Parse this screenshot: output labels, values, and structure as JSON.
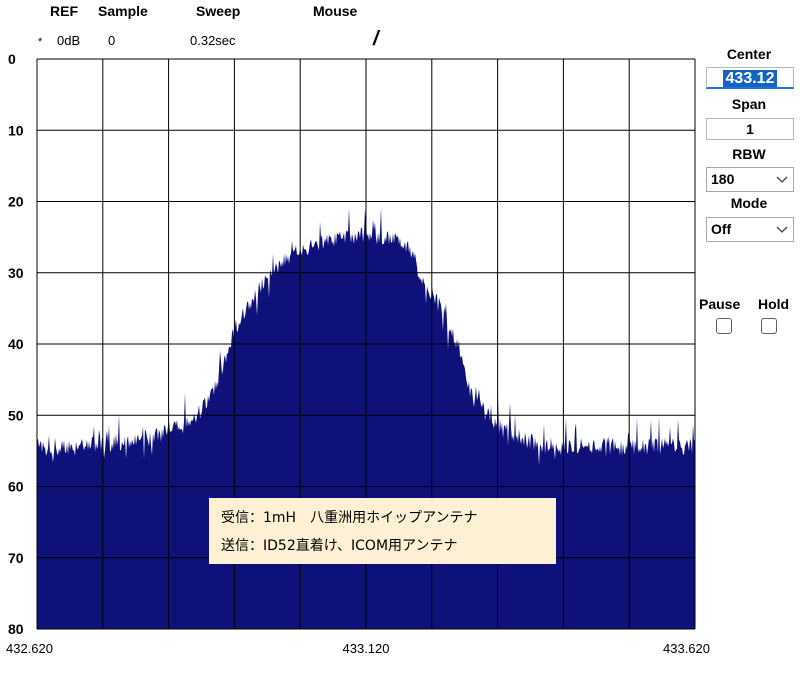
{
  "header": {
    "ref_label": "REF",
    "sample_label": "Sample",
    "sweep_label": "Sweep",
    "mouse_label": "Mouse",
    "ref_marker": "*",
    "ref_value": "0dB",
    "sample_value": "0",
    "sweep_value": "0.32sec",
    "mouse_value": "/"
  },
  "controls": {
    "center_label": "Center",
    "center_value": "433.12",
    "span_label": "Span",
    "span_value": "1",
    "rbw_label": "RBW",
    "rbw_value": "180",
    "mode_label": "Mode",
    "mode_value": "Off",
    "pause_label": "Pause",
    "hold_label": "Hold"
  },
  "annotation": {
    "line1": "受信：1mH　八重洲用ホイップアンテナ",
    "line2": "送信：ID52直着け、ICOM用アンテナ"
  },
  "colors": {
    "trace": "#0f117a",
    "grid": "#000000",
    "highlight": "#1565c0"
  },
  "icons": {
    "dropdown": "chevron-down-icon"
  },
  "chart_data": {
    "type": "area",
    "title": "",
    "xlabel": "",
    "ylabel": "",
    "x_ticks": [
      "432.620",
      "433.120",
      "433.620"
    ],
    "y_ticks": [
      "0",
      "10",
      "20",
      "30",
      "40",
      "50",
      "60",
      "70",
      "80"
    ],
    "xlim": [
      432.62,
      433.62
    ],
    "ylim": [
      0,
      80
    ],
    "y_inverted": true,
    "grid": true,
    "series": [
      {
        "points": [
          [
            432.62,
            54.5
          ],
          [
            432.64,
            54.3
          ],
          [
            432.66,
            54.5
          ],
          [
            432.68,
            54.2
          ],
          [
            432.7,
            54.3
          ],
          [
            432.72,
            54.0
          ],
          [
            432.74,
            54.0
          ],
          [
            432.76,
            53.8
          ],
          [
            432.78,
            53.5
          ],
          [
            432.8,
            53.0
          ],
          [
            432.82,
            52.0
          ],
          [
            432.84,
            51.5
          ],
          [
            432.86,
            50.5
          ],
          [
            432.87,
            49.0
          ],
          [
            432.88,
            48.0
          ],
          [
            432.9,
            44.0
          ],
          [
            432.92,
            38.0
          ],
          [
            432.94,
            35.0
          ],
          [
            432.96,
            32.0
          ],
          [
            432.98,
            30.0
          ],
          [
            433.0,
            28.0
          ],
          [
            433.02,
            26.8
          ],
          [
            433.04,
            26.0
          ],
          [
            433.06,
            25.5
          ],
          [
            433.08,
            25.2
          ],
          [
            433.1,
            25.0
          ],
          [
            433.12,
            24.8
          ],
          [
            433.14,
            25.0
          ],
          [
            433.16,
            25.2
          ],
          [
            433.18,
            26.0
          ],
          [
            433.19,
            27.5
          ],
          [
            433.2,
            30.0
          ],
          [
            433.22,
            33.0
          ],
          [
            433.24,
            36.0
          ],
          [
            433.26,
            40.0
          ],
          [
            433.28,
            47.0
          ],
          [
            433.3,
            49.5
          ],
          [
            433.32,
            51.5
          ],
          [
            433.34,
            52.5
          ],
          [
            433.36,
            53.5
          ],
          [
            433.38,
            54.0
          ],
          [
            433.4,
            54.3
          ],
          [
            433.42,
            54.5
          ],
          [
            433.44,
            54.3
          ],
          [
            433.46,
            54.5
          ],
          [
            433.48,
            54.2
          ],
          [
            433.5,
            54.5
          ],
          [
            433.52,
            54.3
          ],
          [
            433.54,
            54.4
          ],
          [
            433.56,
            54.3
          ],
          [
            433.58,
            54.4
          ],
          [
            433.6,
            54.3
          ],
          [
            433.62,
            54.5
          ]
        ]
      }
    ]
  }
}
